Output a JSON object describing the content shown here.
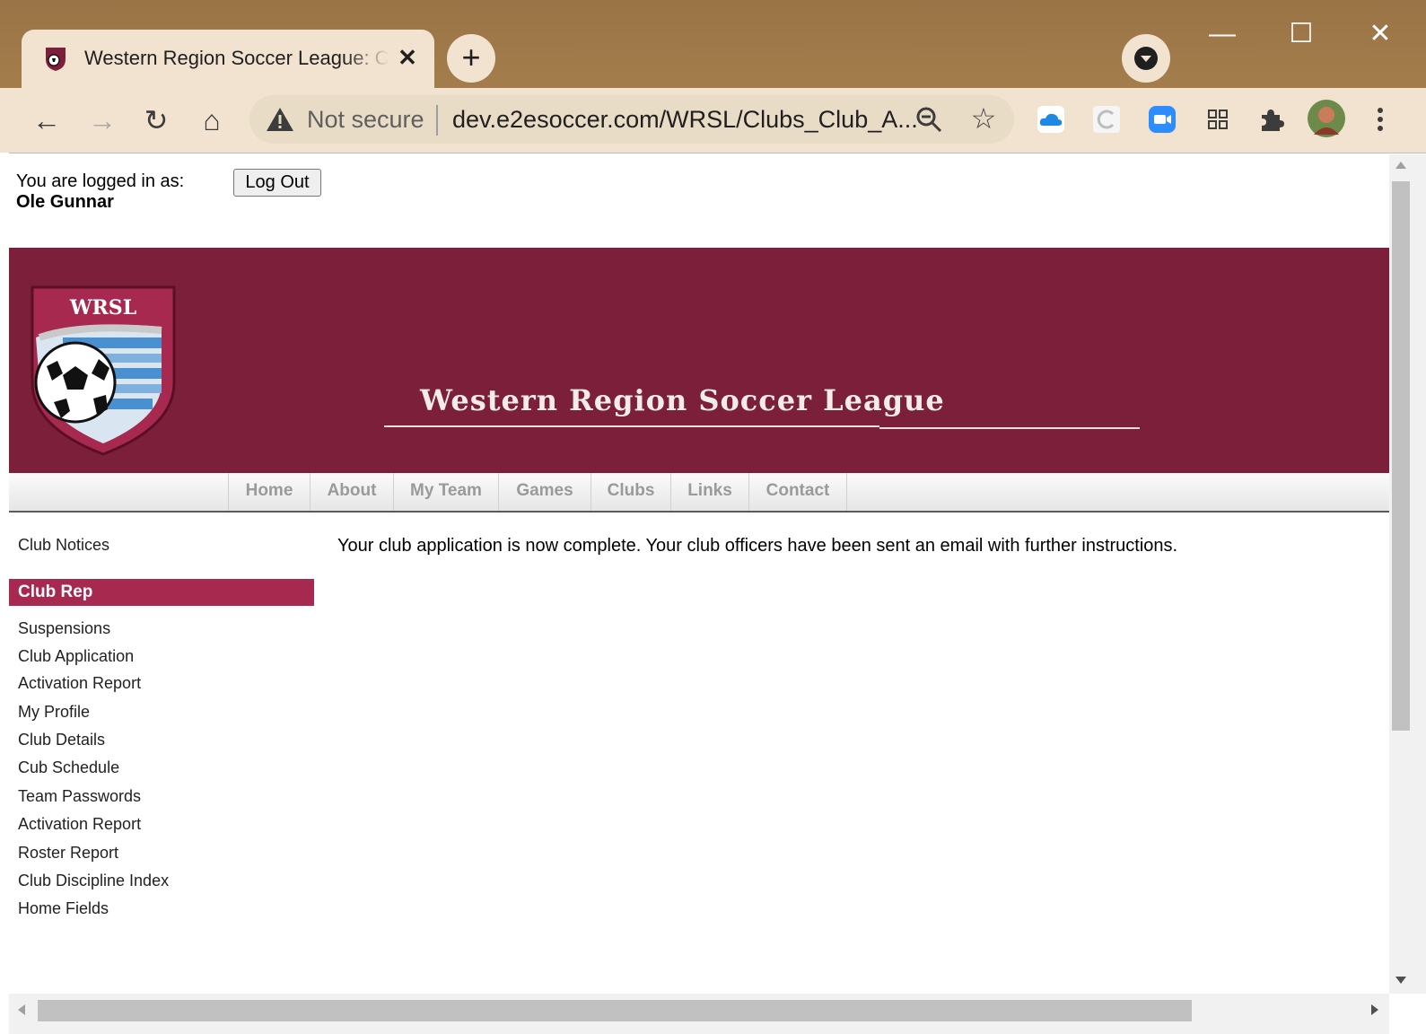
{
  "browser": {
    "tab_title": "Western Region Soccer League: C",
    "tab_close": "✕",
    "new_tab": "+",
    "security_label": "Not secure",
    "url": "dev.e2esoccer.com/WRSL/Clubs_Club_A...",
    "window_controls": {
      "minimize": "—",
      "maximize": "☐",
      "close": "✕"
    },
    "nav": {
      "back": "←",
      "forward": "→",
      "reload": "↻",
      "home": "⌂"
    },
    "icons": [
      "warning-icon",
      "zoom-out-icon",
      "star-icon",
      "cloud-extension-icon",
      "extension-c-icon",
      "zoom-meetings-icon",
      "grid-extension-icon",
      "puzzle-icon",
      "profile-avatar-icon",
      "menu-dots-icon"
    ]
  },
  "login": {
    "label": "You are logged in as:",
    "user": "Ole Gunnar",
    "logout_label": "Log Out"
  },
  "banner": {
    "logo_text": "WRSL",
    "title": "Western Region Soccer League",
    "bg_color": "#7c1f3b"
  },
  "nav": {
    "items": [
      "Home",
      "About",
      "My Team",
      "Games",
      "Clubs",
      "Links",
      "Contact"
    ]
  },
  "sidebar": {
    "notices": "Club Notices",
    "section_title": "Club Rep",
    "section_color": "#a8294f",
    "links": [
      "Suspensions",
      "Club Application",
      "Activation Report",
      "My Profile",
      "Club Details",
      "Cub Schedule",
      "Team Passwords",
      "Activation Report",
      "Roster Report",
      "Club Discipline Index",
      "Home Fields"
    ]
  },
  "main": {
    "message": "Your club application is now complete. Your club officers have been sent an email with further instructions."
  }
}
